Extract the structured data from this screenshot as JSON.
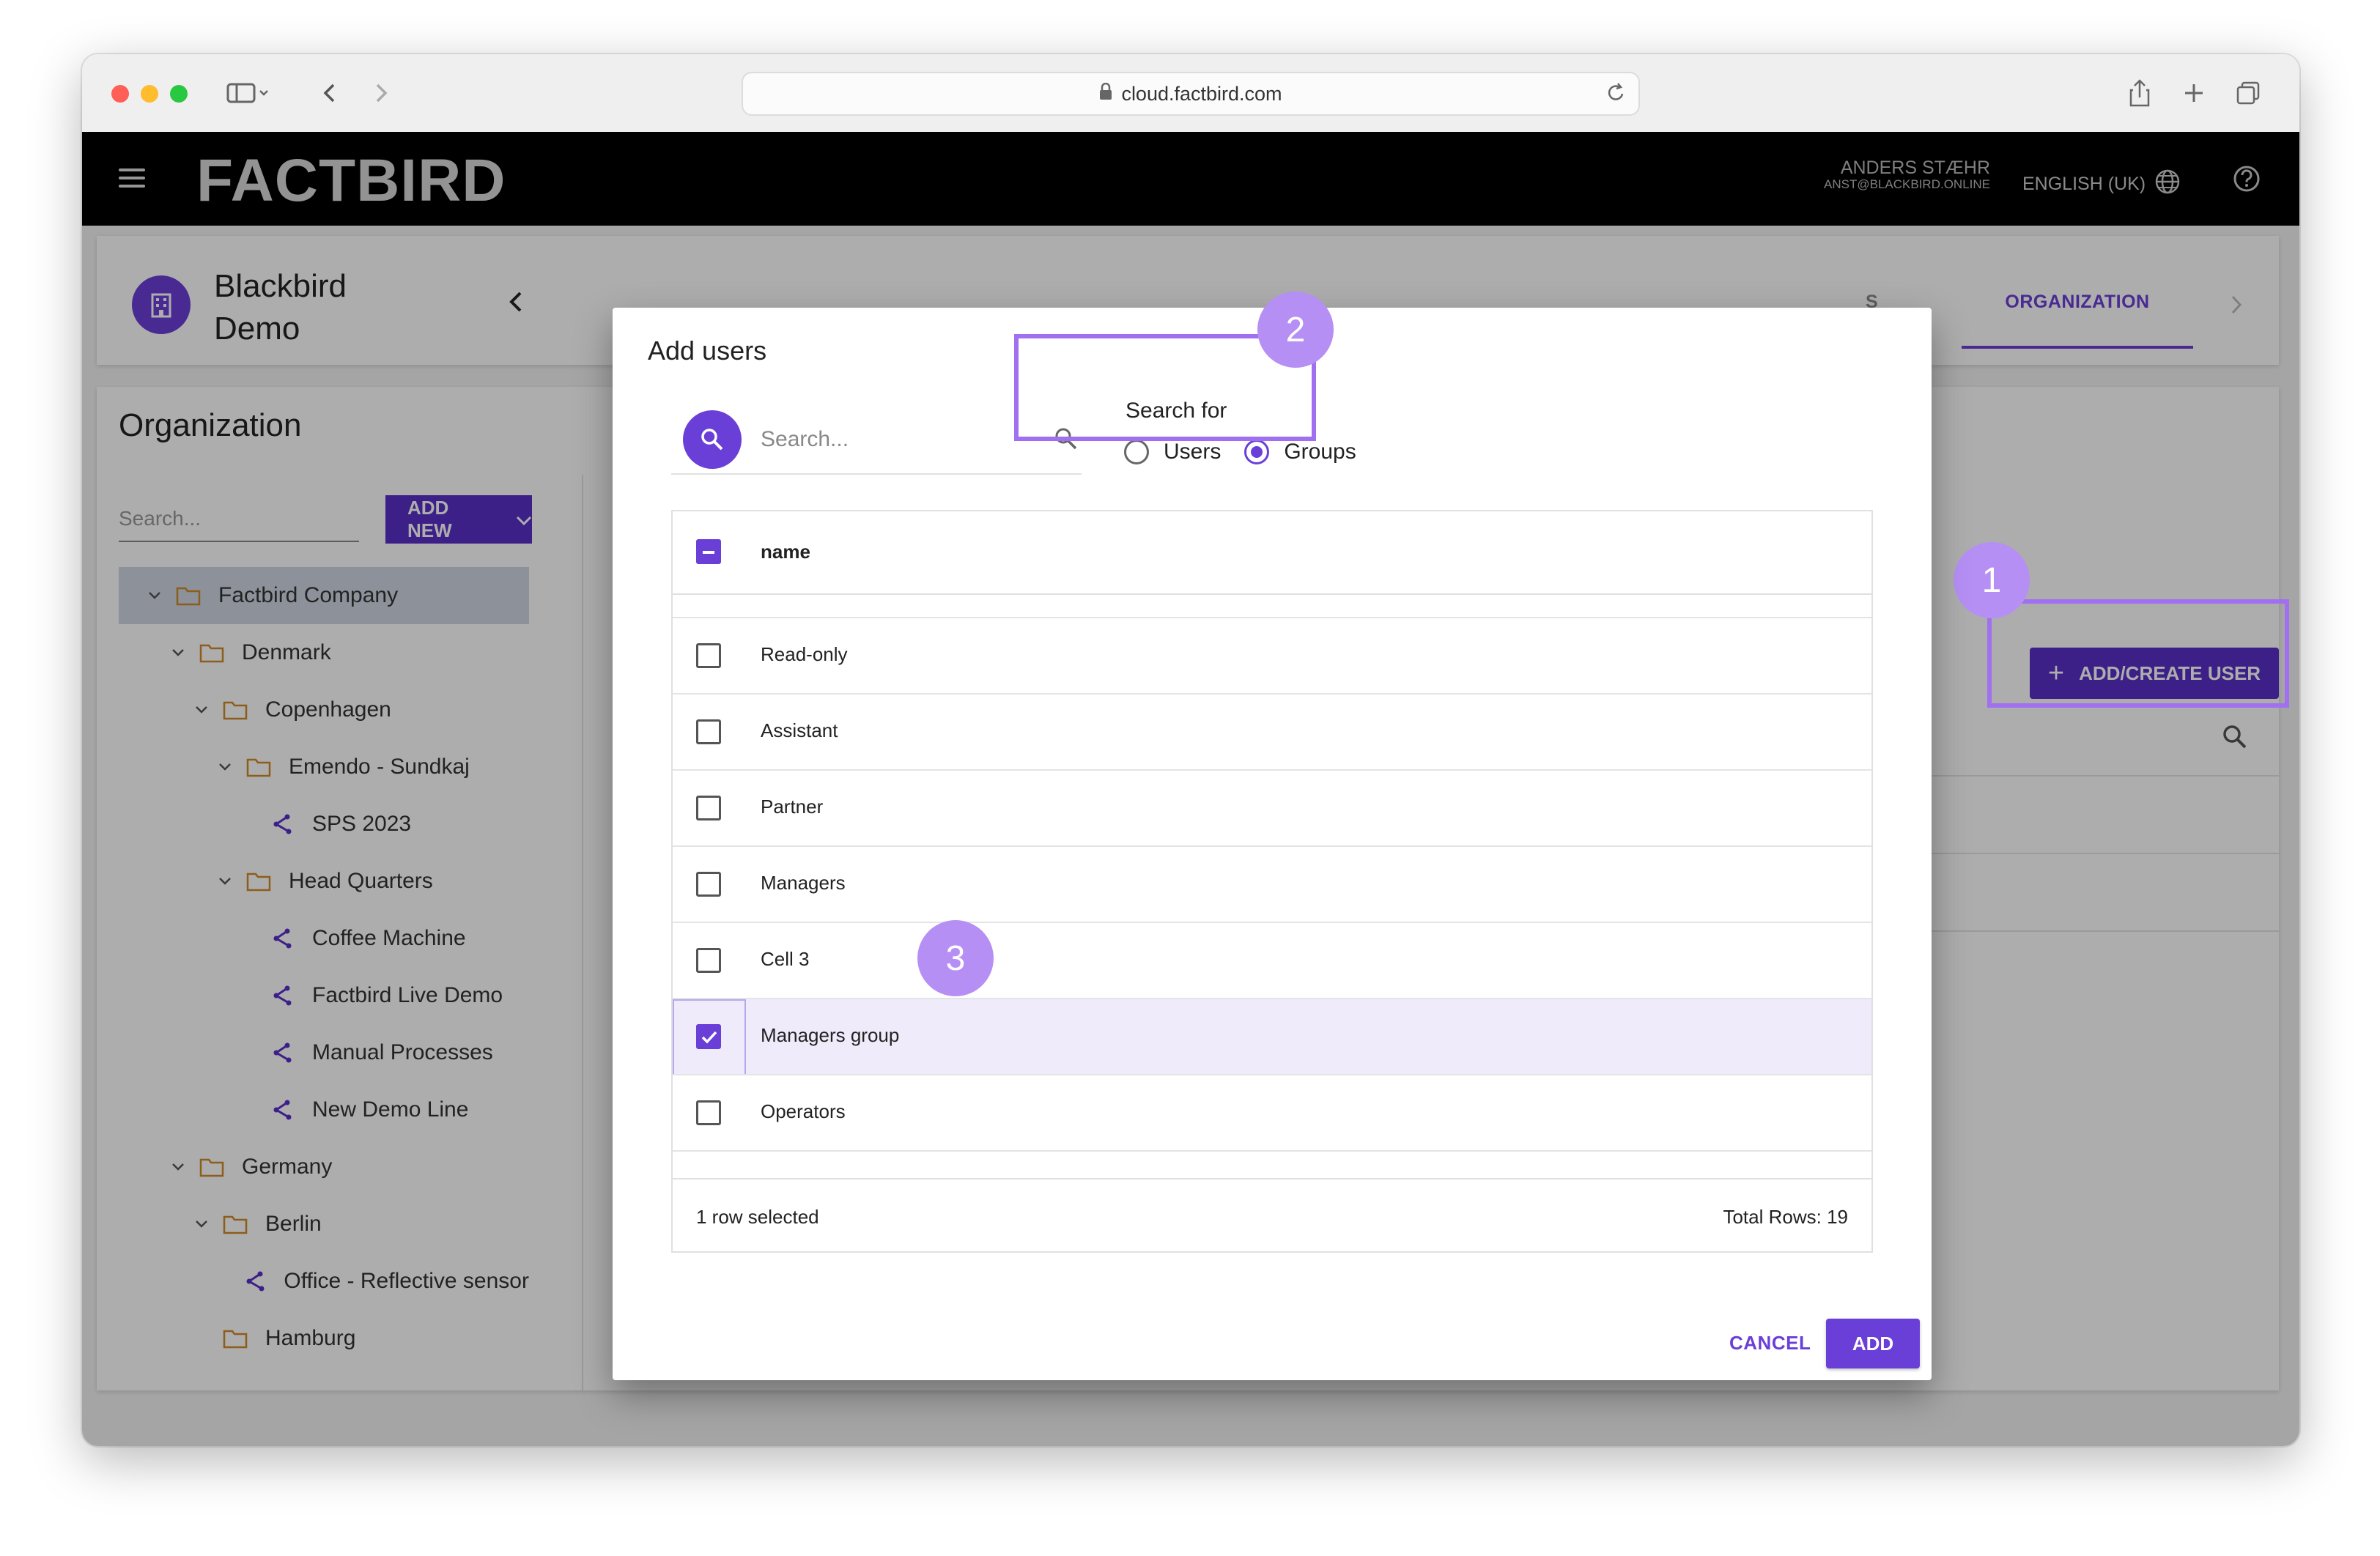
{
  "browser": {
    "url": "cloud.factbird.com"
  },
  "app": {
    "logo": "FACTBIRD",
    "user_name": "ANDERS STÆHR",
    "user_email": "ANST@BLACKBIRD.ONLINE",
    "language": "ENGLISH (UK)"
  },
  "site": {
    "name": "Blackbird\nDemo"
  },
  "tabs": {
    "partial_label": "S",
    "active_label": "ORGANIZATION"
  },
  "organization": {
    "title": "Organization",
    "search_placeholder": "Search...",
    "add_new_label": "ADD NEW",
    "add_create_user_label": "ADD/CREATE USER",
    "tree": [
      {
        "label": "Factbird Company",
        "type": "folder",
        "depth": 0,
        "expanded": true,
        "selected": true
      },
      {
        "label": "Denmark",
        "type": "folder",
        "depth": 1,
        "expanded": true
      },
      {
        "label": "Copenhagen",
        "type": "folder",
        "depth": 2,
        "expanded": true
      },
      {
        "label": "Emendo - Sundkaj",
        "type": "folder",
        "depth": 3,
        "expanded": true
      },
      {
        "label": "SPS 2023",
        "type": "line",
        "depth": 4
      },
      {
        "label": "Head Quarters",
        "type": "folder",
        "depth": 3,
        "expanded": true
      },
      {
        "label": "Coffee Machine",
        "type": "line",
        "depth": 4
      },
      {
        "label": "Factbird Live Demo",
        "type": "line",
        "depth": 4
      },
      {
        "label": "Manual Processes",
        "type": "line",
        "depth": 4
      },
      {
        "label": "New Demo Line",
        "type": "line",
        "depth": 4
      },
      {
        "label": "Germany",
        "type": "folder",
        "depth": 1,
        "expanded": true
      },
      {
        "label": "Berlin",
        "type": "folder",
        "depth": 2,
        "expanded": true
      },
      {
        "label": "Office - Reflective sensor",
        "type": "line",
        "depth": 3
      },
      {
        "label": "Hamburg",
        "type": "folder",
        "depth": 2
      }
    ]
  },
  "dialog": {
    "title": "Add users",
    "search_placeholder": "Search...",
    "search_for_label": "Search for",
    "radio_users": "Users",
    "radio_groups": "Groups",
    "selected_radio": "Groups",
    "column_name": "name",
    "rows": [
      {
        "name": "Read-only",
        "checked": false
      },
      {
        "name": "Assistant",
        "checked": false
      },
      {
        "name": "Partner",
        "checked": false
      },
      {
        "name": "Managers",
        "checked": false
      },
      {
        "name": "Cell 3",
        "checked": false
      },
      {
        "name": "Managers group",
        "checked": true
      },
      {
        "name": "Operators",
        "checked": false
      }
    ],
    "footer_selected": "1 row selected",
    "footer_total": "Total Rows: 19",
    "cancel_label": "CANCEL",
    "add_label": "ADD"
  },
  "annotations": {
    "badge_1": "1",
    "badge_2": "2",
    "badge_3": "3",
    "color": "#a070f0"
  },
  "colors": {
    "accent": "#6a3fd8",
    "header_bg": "#000000"
  }
}
